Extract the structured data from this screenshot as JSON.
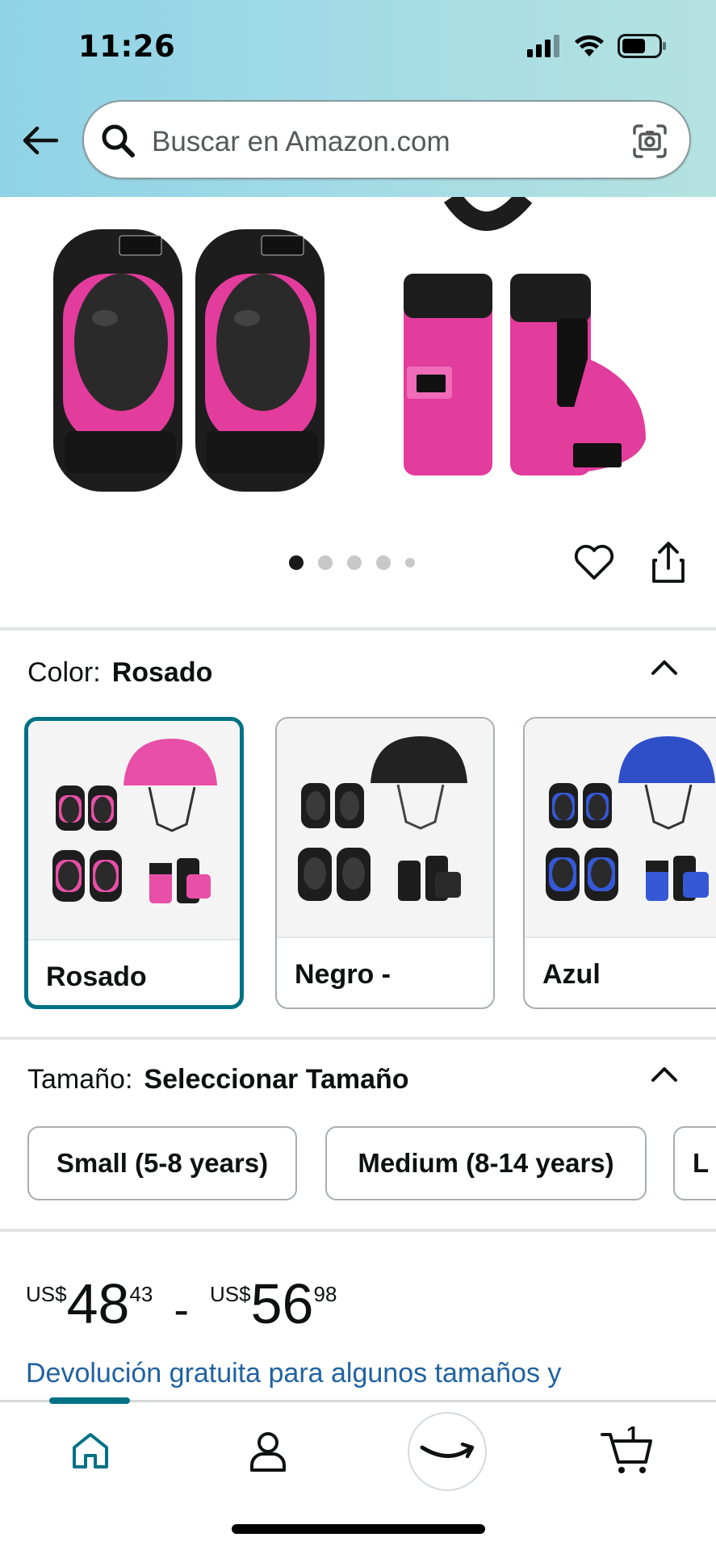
{
  "status_bar": {
    "time": "11:26"
  },
  "search": {
    "placeholder": "Buscar en Amazon.com"
  },
  "carousel": {
    "page_count": 5,
    "current_page": 1
  },
  "color_section": {
    "label": "Color:",
    "selected": "Rosado",
    "options": [
      {
        "label": "Rosado",
        "accent": "#e84fa6",
        "selected": true
      },
      {
        "label": "Negro -",
        "accent": "#2a2a2a",
        "selected": false
      },
      {
        "label": "Azul",
        "accent": "#2f4fc9",
        "selected": false
      }
    ]
  },
  "size_section": {
    "label": "Tamaño:",
    "selected": "Seleccionar Tamaño",
    "options": [
      "Small (5-8 years)",
      "Medium (8-14 years)",
      "L"
    ]
  },
  "price": {
    "low": {
      "currency": "US$",
      "whole": "48",
      "fraction": "43"
    },
    "high": {
      "currency": "US$",
      "whole": "56",
      "fraction": "98"
    },
    "separator": "-"
  },
  "return_text": "Devolución gratuita para algunos tamaños y",
  "bottom_nav": {
    "items": [
      "home-icon",
      "account-icon",
      "amazon-smile-icon",
      "cart-icon"
    ],
    "cart_count": "1"
  },
  "colors": {
    "accent_teal": "#007185",
    "link_blue": "#2162a1",
    "header_start": "#8fd3e6",
    "header_end": "#b4e2e0"
  }
}
